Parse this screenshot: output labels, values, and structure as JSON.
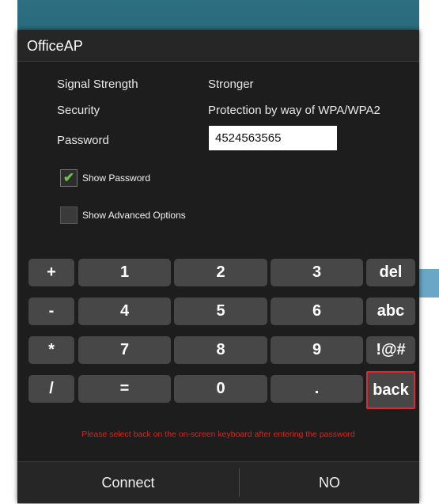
{
  "dialog": {
    "title": "OfficeAP",
    "signal_label": "Signal Strength",
    "signal_value": "Stronger",
    "security_label": "Security",
    "security_value": "Protection by way of WPA/WPA2",
    "password_label": "Password",
    "password_value": "4524563565",
    "show_password": {
      "label": "Show Password",
      "checked": true
    },
    "show_advanced": {
      "label": "Show Advanced Options",
      "checked": false
    }
  },
  "keypad": {
    "row1": [
      "+",
      "1",
      "2",
      "3",
      "del"
    ],
    "row2": [
      "-",
      "4",
      "5",
      "6",
      "abc"
    ],
    "row3": [
      "*",
      "7",
      "8",
      "9",
      "!@#"
    ],
    "row4": [
      "/",
      "=",
      "0",
      ".",
      "back"
    ],
    "highlighted_key": "back",
    "highlight_color": "#e0282e"
  },
  "hint": "Please select back on the on-screen keyboard after entering the password",
  "hint_color": "#d8241f",
  "buttons": {
    "connect": "Connect",
    "no": "NO"
  },
  "icons": {
    "checkmark": "checkmark-icon"
  }
}
